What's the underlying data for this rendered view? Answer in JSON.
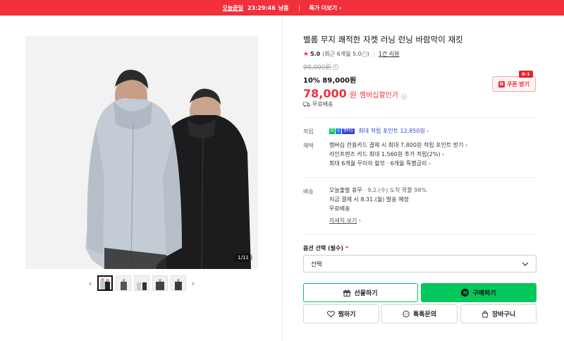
{
  "topbar": {
    "deal_label": "오늘끝딜",
    "timer": "23:29:46",
    "timer_suffix": "남음",
    "more_label": "특가 더보기",
    "bg_color": "#f1303b"
  },
  "gallery": {
    "counter": "1/11",
    "thumb_count": 5
  },
  "product": {
    "title": "밸롬 무지 쾌적한 자켓 러닝 런닝 바람막이 재킷",
    "rating": "5.0",
    "rating_sub": "(최근 6개월 5.0",
    "rating_sub_close": ")",
    "review_link": "1건 리뷰",
    "original_price": "99,000원",
    "discount_text": "10% 89,000원",
    "member_price": "78,000",
    "member_won": "원",
    "member_label": "멤버십할인가",
    "delivery": "무료배송"
  },
  "coupon": {
    "badge": "0-1",
    "label": "쿠폰 받기"
  },
  "points": {
    "label": "적립",
    "text": "최대 적립 포인트 12,850원",
    "npay": [
      "N",
      "+",
      "멤버십"
    ]
  },
  "benefits": {
    "label": "혜택",
    "lines": [
      "멤버십 전용카드 결제 시 최대 7,800원 적립 포인트 받기",
      "라인프렌즈 카드 최대 1,560원 추가 적립(2%)",
      "최대 6개월 무이자 할부 · 6개월 특별금리"
    ]
  },
  "shipping": {
    "label": "배송",
    "line1_a": "오늘출발 휴무",
    "line1_b": "· 9.2.(수) 도착 확률 98%",
    "line2": "지금 결제 시 8.31.(월) 발송 예정",
    "line3": "무료배송",
    "detail_link": "자세히 보기"
  },
  "option": {
    "label": "옵션 선택 (필수)",
    "required_mark": "*",
    "select_value": "선택"
  },
  "buttons": {
    "gift": "선물하기",
    "buy": "구매하기",
    "wish": "찜하기",
    "talk": "톡톡문의",
    "cart": "장바구니"
  },
  "colors": {
    "accent_red": "#f1303b",
    "naver_green": "#03c75a",
    "points_blue": "#3b46d1"
  }
}
